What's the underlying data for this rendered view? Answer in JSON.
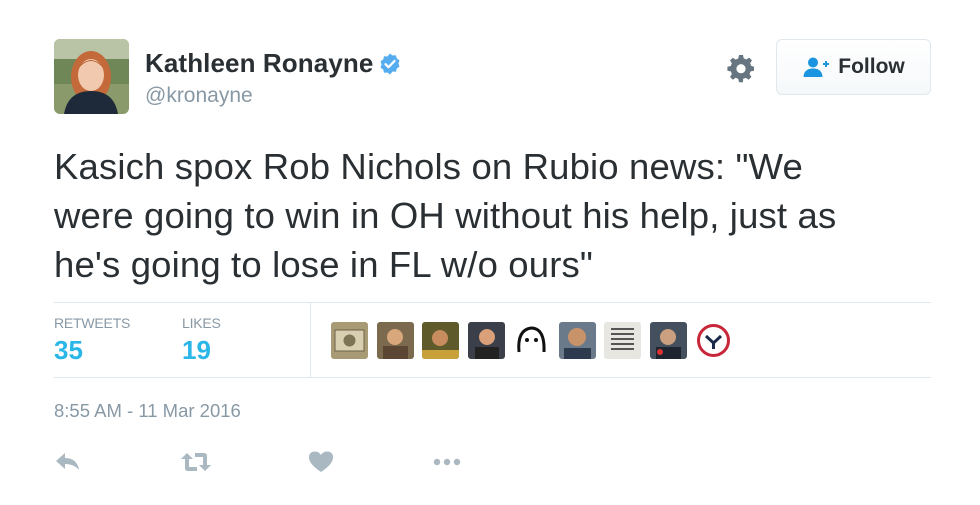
{
  "user": {
    "full_name": "Kathleen Ronayne",
    "handle": "@kronayne",
    "verified": true
  },
  "follow_button": {
    "label": "Follow",
    "icon": "add-person-icon"
  },
  "tweet": {
    "text_lines": [
      "Kasich spox Rob Nichols on Rubio news: \"We",
      "were going to win in OH without his help, just as",
      "he's going to lose in FL w/o ours\""
    ]
  },
  "stats": {
    "retweets_label": "RETWEETS",
    "retweets_count": "35",
    "likes_label": "LIKES",
    "likes_count": "19"
  },
  "timestamp": "8:55 AM - 11 Mar 2016",
  "colors": {
    "accent": "#2bb6e8",
    "text": "#292f33",
    "muted": "#8899a6",
    "border": "#e1e8ed",
    "verified": "#55acee"
  },
  "icons": [
    "gear-icon",
    "verified-icon",
    "reply-icon",
    "retweet-icon",
    "like-icon",
    "more-icon"
  ]
}
